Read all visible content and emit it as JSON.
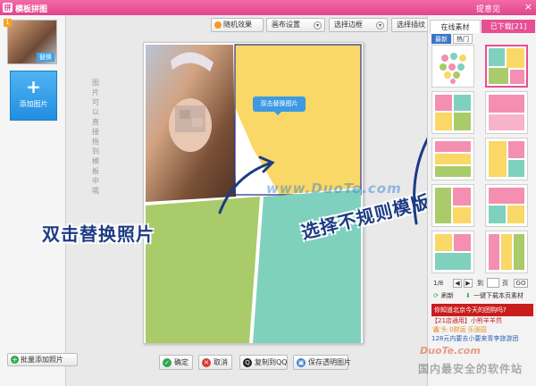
{
  "titlebar": {
    "title": "模板拼图",
    "feedback": "提意见",
    "close": "×",
    "logo": "拼"
  },
  "left": {
    "thumb_num": "1",
    "thumb_swap": "替换",
    "add_label": "添加图片",
    "add_plus": "+",
    "batch_label": "批量添加照片"
  },
  "toolbar": {
    "random": "随机效果",
    "layout": "画布设置",
    "border": "选择边框",
    "effect": "选择插纹"
  },
  "canvas": {
    "tooltip": "双击替换图片",
    "vertical_hint": "图片可以直接拖到模板中哦",
    "hint_left": "双击替换照片",
    "hint_right": "选择不规则模版",
    "watermark": "www.DuoTe.com"
  },
  "bottom": {
    "confirm": "确定",
    "cancel": "取消",
    "copy_qq": "复制到QQ",
    "save": "保存透明图片"
  },
  "right": {
    "tab_online": "在线素材",
    "tab_downloaded": "已下载[21]",
    "sub_new": "最新",
    "sub_hot": "热门",
    "pager": {
      "page": "1/8",
      "goto": "到",
      "unit": "页",
      "go": "GO"
    },
    "refresh": "刷新",
    "download_all": "一键下载本页素材",
    "notice": "你知道北京今天的团购吗?",
    "ad_lines": [
      "【21店通用】小熊羊羊然",
      "'鑫'头 0财运 乐涨园",
      "128元内要去小要来青李旅游团"
    ]
  },
  "watermarks": {
    "duote": "DuoTe.com",
    "site": "国内最安全的软件站"
  },
  "colors": {
    "brand_pink": "#e74f93",
    "blue": "#3d9ae2",
    "yellow": "#f9d867",
    "green": "#a9cb6a",
    "teal": "#7fd1be",
    "navy": "#1d3b84"
  }
}
